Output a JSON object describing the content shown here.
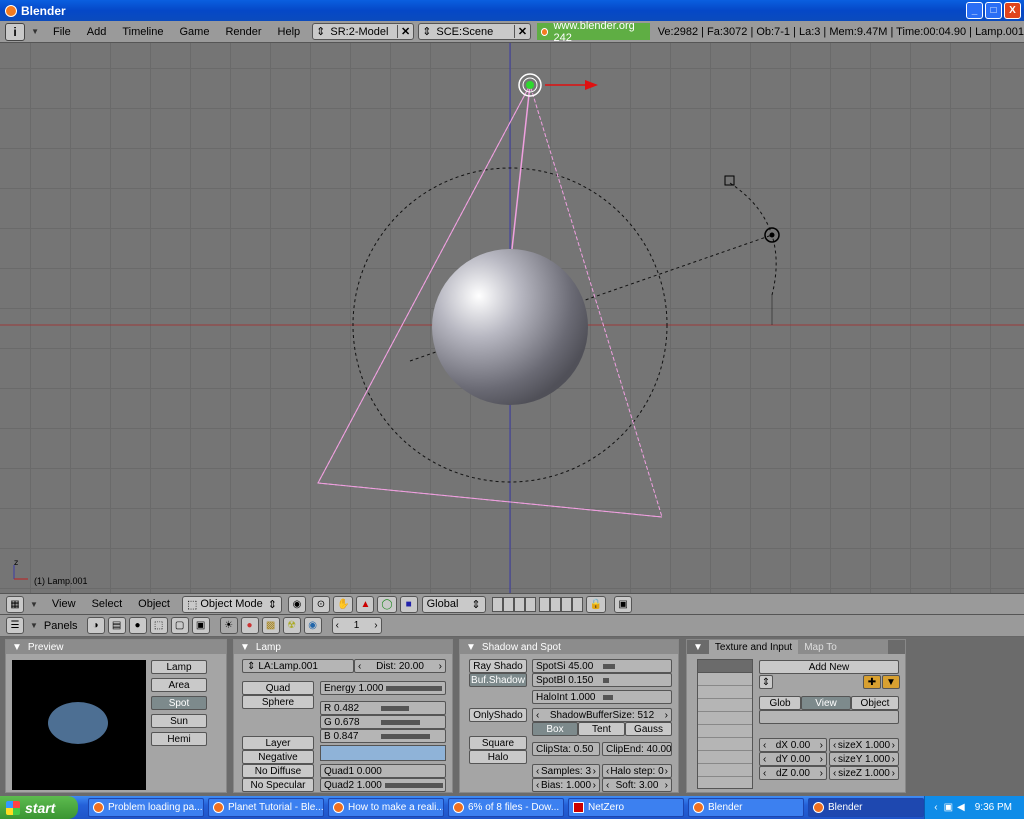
{
  "window": {
    "title": "Blender",
    "buttons": [
      "_",
      "□",
      "X"
    ]
  },
  "topbar": {
    "menus": [
      "File",
      "Add",
      "Timeline",
      "Game",
      "Render",
      "Help"
    ],
    "screen_field": "SR:2-Model",
    "scene_field": "SCE:Scene",
    "url": "www.blender.org 242",
    "stats": "Ve:2982 | Fa:3072 | Ob:7-1 | La:3 | Mem:9.47M | Time:00:04.90 | Lamp.001"
  },
  "viewport": {
    "object_label": "(1) Lamp.001",
    "axis_label": "z"
  },
  "view_header": {
    "menus": [
      "View",
      "Select",
      "Object"
    ],
    "mode": "Object Mode",
    "orientation": "Global"
  },
  "buttons_header": {
    "panels_label": "Panels",
    "frame": "1"
  },
  "panels": {
    "preview": {
      "title": "Preview",
      "types": [
        "Lamp",
        "Area",
        "Spot",
        "Sun",
        "Hemi"
      ],
      "selected_type": "Spot"
    },
    "lamp": {
      "title": "Lamp",
      "name": "LA:Lamp.001",
      "dist": "Dist: 20.00",
      "quad": "Quad",
      "sphere": "Sphere",
      "energy": "Energy 1.000",
      "r": "R 0.482",
      "g": "G 0.678",
      "b": "B 0.847",
      "layer": "Layer",
      "negative": "Negative",
      "no_diffuse": "No Diffuse",
      "no_specular": "No Specular",
      "quad1": "Quad1 0.000",
      "quad2": "Quad2 1.000",
      "color": "#8fb3d8",
      "energy_level": 1.0,
      "r_level": 0.482,
      "g_level": 0.678,
      "b_level": 0.847
    },
    "shadow": {
      "title": "Shadow and Spot",
      "ray_shadow": "Ray Shado",
      "buf_shadow": "Buf.Shadow",
      "only_shadow": "OnlyShado",
      "square": "Square",
      "halo": "Halo",
      "spotsi": "SpotSi 45.00",
      "spotbl": "SpotBl 0.150",
      "haloint": "HaloInt 1.000",
      "buffer_size": "ShadowBufferSize: 512",
      "box": "Box",
      "tent": "Tent",
      "gauss": "Gauss",
      "clipsta": "ClipSta: 0.50",
      "clipend": "ClipEnd: 40.00",
      "samples": "Samples: 3",
      "halo_step": "Halo step: 0",
      "bias": "Bias: 1.000",
      "soft": "Soft: 3.00"
    },
    "texture": {
      "tab_active": "Texture and Input",
      "tab_inactive": "Map To",
      "add_new": "Add New",
      "glob": "Glob",
      "view": "View",
      "object": "Object",
      "dx": "dX 0.00",
      "dy": "dY 0.00",
      "dz": "dZ 0.00",
      "sizex": "sizeX 1.000",
      "sizey": "sizeY 1.000",
      "sizez": "sizeZ 1.000"
    }
  },
  "taskbar": {
    "start": "start",
    "tasks": [
      "Problem loading pa...",
      "Planet Tutorial - Ble...",
      "How to make a reali...",
      "6% of 8 files - Dow...",
      "NetZero",
      "Blender",
      "Blender"
    ],
    "clock": "9:36 PM"
  }
}
